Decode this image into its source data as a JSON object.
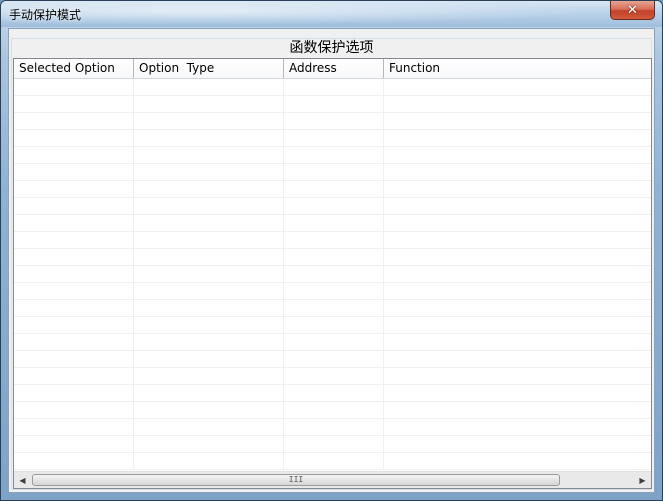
{
  "window": {
    "title": "手动保护模式",
    "close_glyph": "✕"
  },
  "group": {
    "title": "函数保护选项"
  },
  "list": {
    "columns": [
      {
        "label": "Selected Option"
      },
      {
        "label": "Option  Type"
      },
      {
        "label": "Address"
      },
      {
        "label": "Function"
      }
    ],
    "rows": []
  },
  "scrollbar": {
    "left_glyph": "◀",
    "right_glyph": "▶",
    "grip_glyph": "III"
  },
  "colors": {
    "frame": "#7fa3c7",
    "close_button": "#c2412a",
    "client_bg": "#f0f0f0",
    "list_bg": "#ffffff"
  }
}
